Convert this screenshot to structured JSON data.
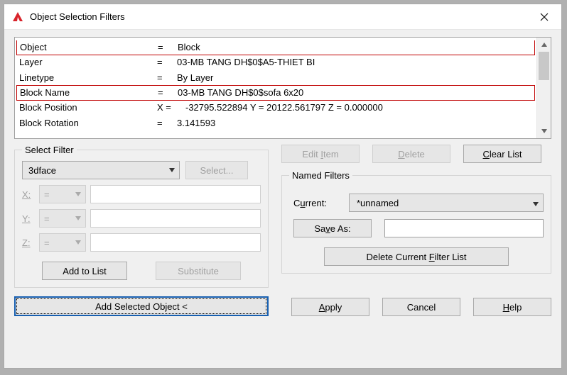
{
  "window": {
    "title": "Object Selection Filters"
  },
  "list": {
    "rows": [
      {
        "name": "Object",
        "op": "=",
        "val": "Block",
        "highlight": true
      },
      {
        "name": "Layer",
        "op": "=",
        "val": "03-MB TANG DH$0$A5-THIET BI"
      },
      {
        "name": "Linetype",
        "op": "=",
        "val": "By Layer"
      },
      {
        "name": "Block Name",
        "op": "=",
        "val": "03-MB TANG DH$0$sofa 6x20",
        "highlight": true
      },
      {
        "name": "Block Position",
        "op": "X =",
        "val": "-32795.522894      Y  =  20122.561797      Z  =  0.000000"
      },
      {
        "name": "Block Rotation",
        "op": "=",
        "val": "3.141593"
      }
    ]
  },
  "selectFilter": {
    "legend": "Select Filter",
    "combo": "3dface",
    "selectBtn": "Select...",
    "coords": [
      {
        "label": "X:",
        "op": "="
      },
      {
        "label": "Y:",
        "op": "="
      },
      {
        "label": "Z:",
        "op": "="
      }
    ],
    "addToList": "Add to List",
    "substitute": "Substitute",
    "addSelected": "Add Selected Object <"
  },
  "rightTop": {
    "editItem": "Edit Item",
    "delete": "Delete",
    "clearList": "Clear List"
  },
  "namedFilters": {
    "legend": "Named Filters",
    "currentLabel": "Current:",
    "currentValue": "*unnamed",
    "saveAs": "Save As:",
    "saveAsValue": "",
    "deleteCurrent": "Delete Current Filter List"
  },
  "bottom": {
    "apply": "Apply",
    "cancel": "Cancel",
    "help": "Help"
  }
}
